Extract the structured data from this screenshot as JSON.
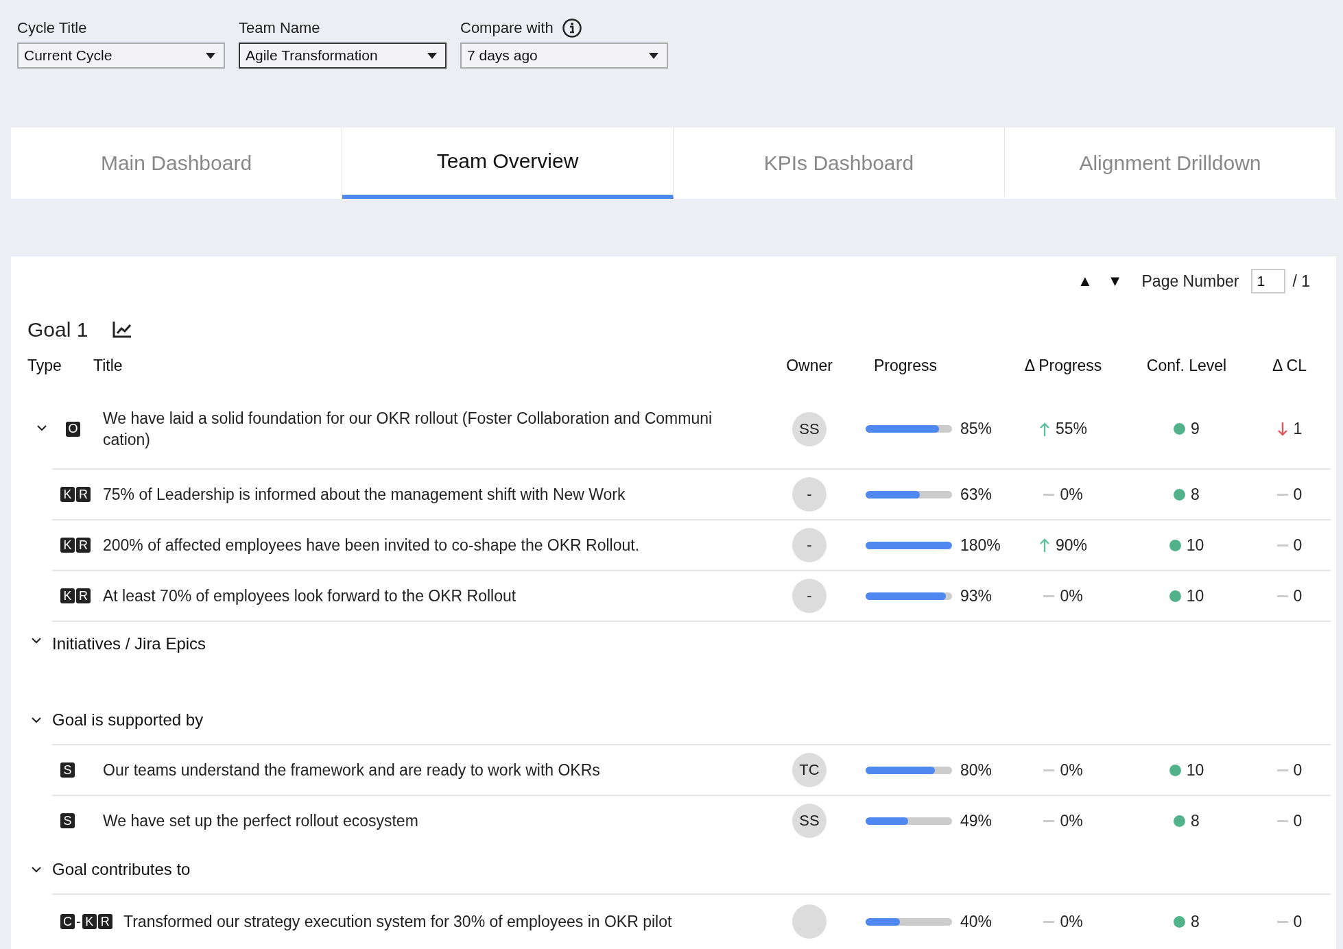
{
  "filters": [
    {
      "label": "Cycle Title",
      "value": "Current Cycle",
      "info": false,
      "focused": false
    },
    {
      "label": "Team Name",
      "value": "Agile Transformation",
      "info": false,
      "focused": true
    },
    {
      "label": "Compare with",
      "value": "7 days ago",
      "info": true,
      "focused": false
    }
  ],
  "tabs": [
    {
      "label": "Main Dashboard",
      "selected": false
    },
    {
      "label": "Team Overview",
      "selected": true
    },
    {
      "label": "KPIs Dashboard",
      "selected": false
    },
    {
      "label": "Alignment Drilldown",
      "selected": false
    }
  ],
  "pager": {
    "arrows": [
      "▲",
      "▼"
    ],
    "label": "Page Number",
    "value": "1",
    "total": "/ 1"
  },
  "goal": {
    "title": "Goal 1",
    "columns": [
      "Type",
      "Title",
      "Owner",
      "Progress",
      "Δ Progress",
      "Conf. Level",
      "Δ CL"
    ],
    "objective": {
      "expanded": true,
      "badge": [
        {
          "text": "O",
          "boxed": true
        }
      ],
      "title": "We have laid a solid foundation for our OKR rollout (Foster Collaboration and Communication)",
      "owner": "SS",
      "level": 0.85,
      "progress": "85%",
      "delta": {
        "kind": "up",
        "text": "55%"
      },
      "confidence": {
        "color": "#52b38a",
        "text": "9"
      },
      "cl_delta": {
        "kind": "down",
        "text": "1"
      }
    },
    "key_results": [
      {
        "badge": [
          {
            "text": "K",
            "boxed": true
          },
          {
            "text": "R",
            "boxed": true
          }
        ],
        "title": "75% of Leadership is informed about the management shift with New Work",
        "owner": "-",
        "level": 0.63,
        "progress": "63%",
        "delta": {
          "kind": "flat",
          "text": "0%"
        },
        "confidence": {
          "color": "#52b38a",
          "text": "8"
        },
        "cl_delta": {
          "kind": "flat",
          "text": "0"
        }
      },
      {
        "badge": [
          {
            "text": "K",
            "boxed": true
          },
          {
            "text": "R",
            "boxed": true
          }
        ],
        "title": "200% of affected employees have been invited to co-shape the OKR Rollout.",
        "owner": "-",
        "level": 1.0,
        "progress": "180%",
        "delta": {
          "kind": "up",
          "text": "90%"
        },
        "confidence": {
          "color": "#52b38a",
          "text": "10"
        },
        "cl_delta": {
          "kind": "flat",
          "text": "0"
        }
      },
      {
        "badge": [
          {
            "text": "K",
            "boxed": true
          },
          {
            "text": "R",
            "boxed": true
          }
        ],
        "title": "At least 70% of employees look forward to the OKR Rollout",
        "owner": "-",
        "level": 0.93,
        "progress": "93%",
        "delta": {
          "kind": "flat",
          "text": "0%"
        },
        "confidence": {
          "color": "#52b38a",
          "text": "10"
        },
        "cl_delta": {
          "kind": "flat",
          "text": "0"
        }
      }
    ]
  },
  "sections": [
    {
      "title": "Initiatives / Jira Epics",
      "expanded": true
    },
    {
      "title": "Goal is supported by",
      "expanded": true,
      "rows": [
        {
          "badge": [
            {
              "text": "S",
              "boxed": true
            }
          ],
          "title": "Our teams understand the framework and are ready to work with OKRs",
          "owner": "TC",
          "level": 0.8,
          "progress": "80%",
          "delta": {
            "kind": "flat",
            "text": "0%"
          },
          "confidence": {
            "color": "#52b38a",
            "text": "10"
          },
          "cl_delta": {
            "kind": "flat",
            "text": "0"
          }
        },
        {
          "badge": [
            {
              "text": "S",
              "boxed": true
            }
          ],
          "title": "We have set up the perfect rollout ecosystem",
          "owner": "SS",
          "level": 0.49,
          "progress": "49%",
          "delta": {
            "kind": "flat",
            "text": "0%"
          },
          "confidence": {
            "color": "#52b38a",
            "text": "8"
          },
          "cl_delta": {
            "kind": "flat",
            "text": "0"
          }
        }
      ]
    },
    {
      "title": "Goal contributes to",
      "expanded": true,
      "rows": [
        {
          "badge": [
            {
              "text": "C",
              "boxed": true
            },
            {
              "text": "-",
              "boxed": false
            },
            {
              "text": "K",
              "boxed": true
            },
            {
              "text": "R",
              "boxed": true
            }
          ],
          "title": "Transformed our strategy execution system for 30% of employees in OKR pilot",
          "level": 0.4,
          "progress": "40%",
          "delta": {
            "kind": "flat",
            "text": "0%"
          },
          "confidence": {
            "color": "#52b38a",
            "text": "8"
          },
          "cl_delta": {
            "kind": "flat",
            "text": "0"
          }
        }
      ]
    }
  ]
}
